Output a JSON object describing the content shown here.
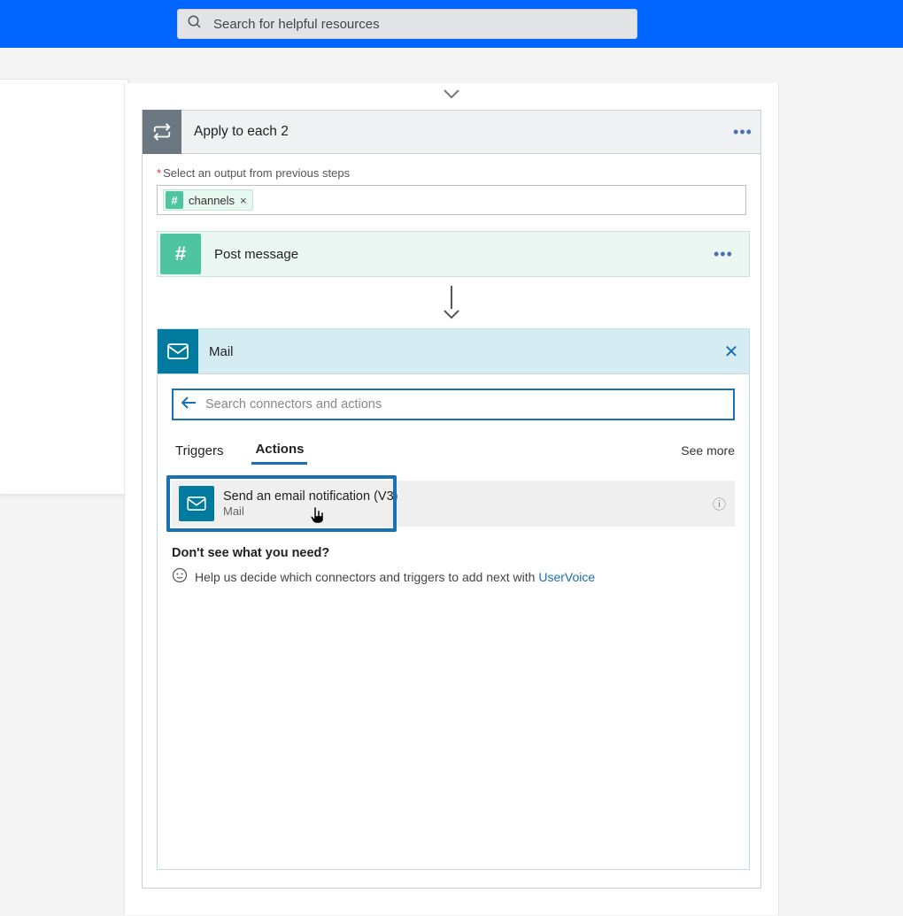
{
  "topbar": {
    "search_placeholder": "Search for helpful resources"
  },
  "step": {
    "title": "Apply to each 2",
    "output_label": "Select an output from previous steps",
    "token": {
      "label": "channels"
    }
  },
  "post_action": {
    "title": "Post message"
  },
  "connector": {
    "title": "Mail",
    "search_placeholder": "Search connectors and actions",
    "tabs": {
      "triggers": "Triggers",
      "actions": "Actions"
    },
    "see_more": "See more",
    "result": {
      "title": "Send an email notification (V3)",
      "subtitle": "Mail"
    },
    "help": {
      "question": "Don't see what you need?",
      "text": "Help us decide which connectors and triggers to add next with ",
      "link": "UserVoice"
    }
  }
}
